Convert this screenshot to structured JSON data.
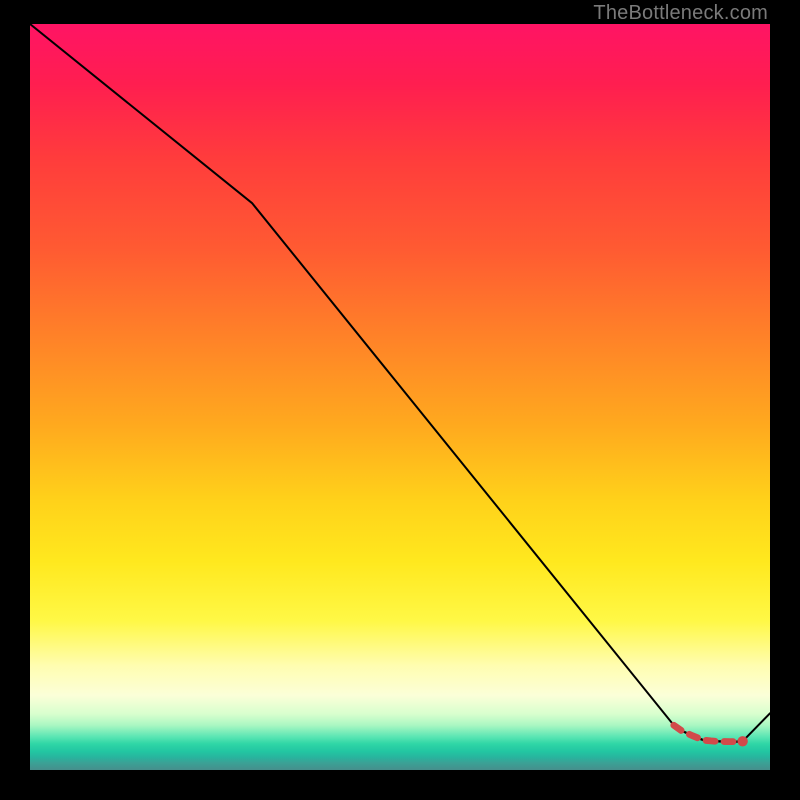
{
  "watermark": "TheBottleneck.com",
  "chart_data": {
    "type": "line",
    "title": "",
    "xlabel": "",
    "ylabel": "",
    "xlim": [
      0,
      100
    ],
    "ylim": [
      0,
      100
    ],
    "series": [
      {
        "name": "curve",
        "x": [
          0,
          30,
          87,
          88,
          89.5,
          90.5,
          91,
          92,
          92.7,
          93.5,
          94.5,
          95.5,
          96.3,
          100
        ],
        "y": [
          100,
          76,
          6,
          5.3,
          4.6,
          4.2,
          4.0,
          3.9,
          3.85,
          3.82,
          3.8,
          3.8,
          3.85,
          7.6
        ]
      }
    ],
    "dashed_segment": {
      "name": "dashed-red-flat",
      "x": [
        87,
        88,
        89.5,
        90.5,
        91,
        92,
        92.7,
        93.5,
        94.5,
        95.5,
        96.3
      ],
      "y": [
        6,
        5.3,
        4.6,
        4.2,
        4.0,
        3.9,
        3.85,
        3.82,
        3.8,
        3.8,
        3.85
      ],
      "color": "#d24a4a"
    },
    "background_gradient": {
      "direction": "top-to-bottom",
      "stops": [
        {
          "pos": 0.0,
          "color": "#ff1464"
        },
        {
          "pos": 0.3,
          "color": "#ff5a32"
        },
        {
          "pos": 0.64,
          "color": "#ffd21a"
        },
        {
          "pos": 0.86,
          "color": "#fffdb0"
        },
        {
          "pos": 0.95,
          "color": "#5ce6b4"
        },
        {
          "pos": 1.0,
          "color": "#468e8c"
        }
      ]
    }
  }
}
